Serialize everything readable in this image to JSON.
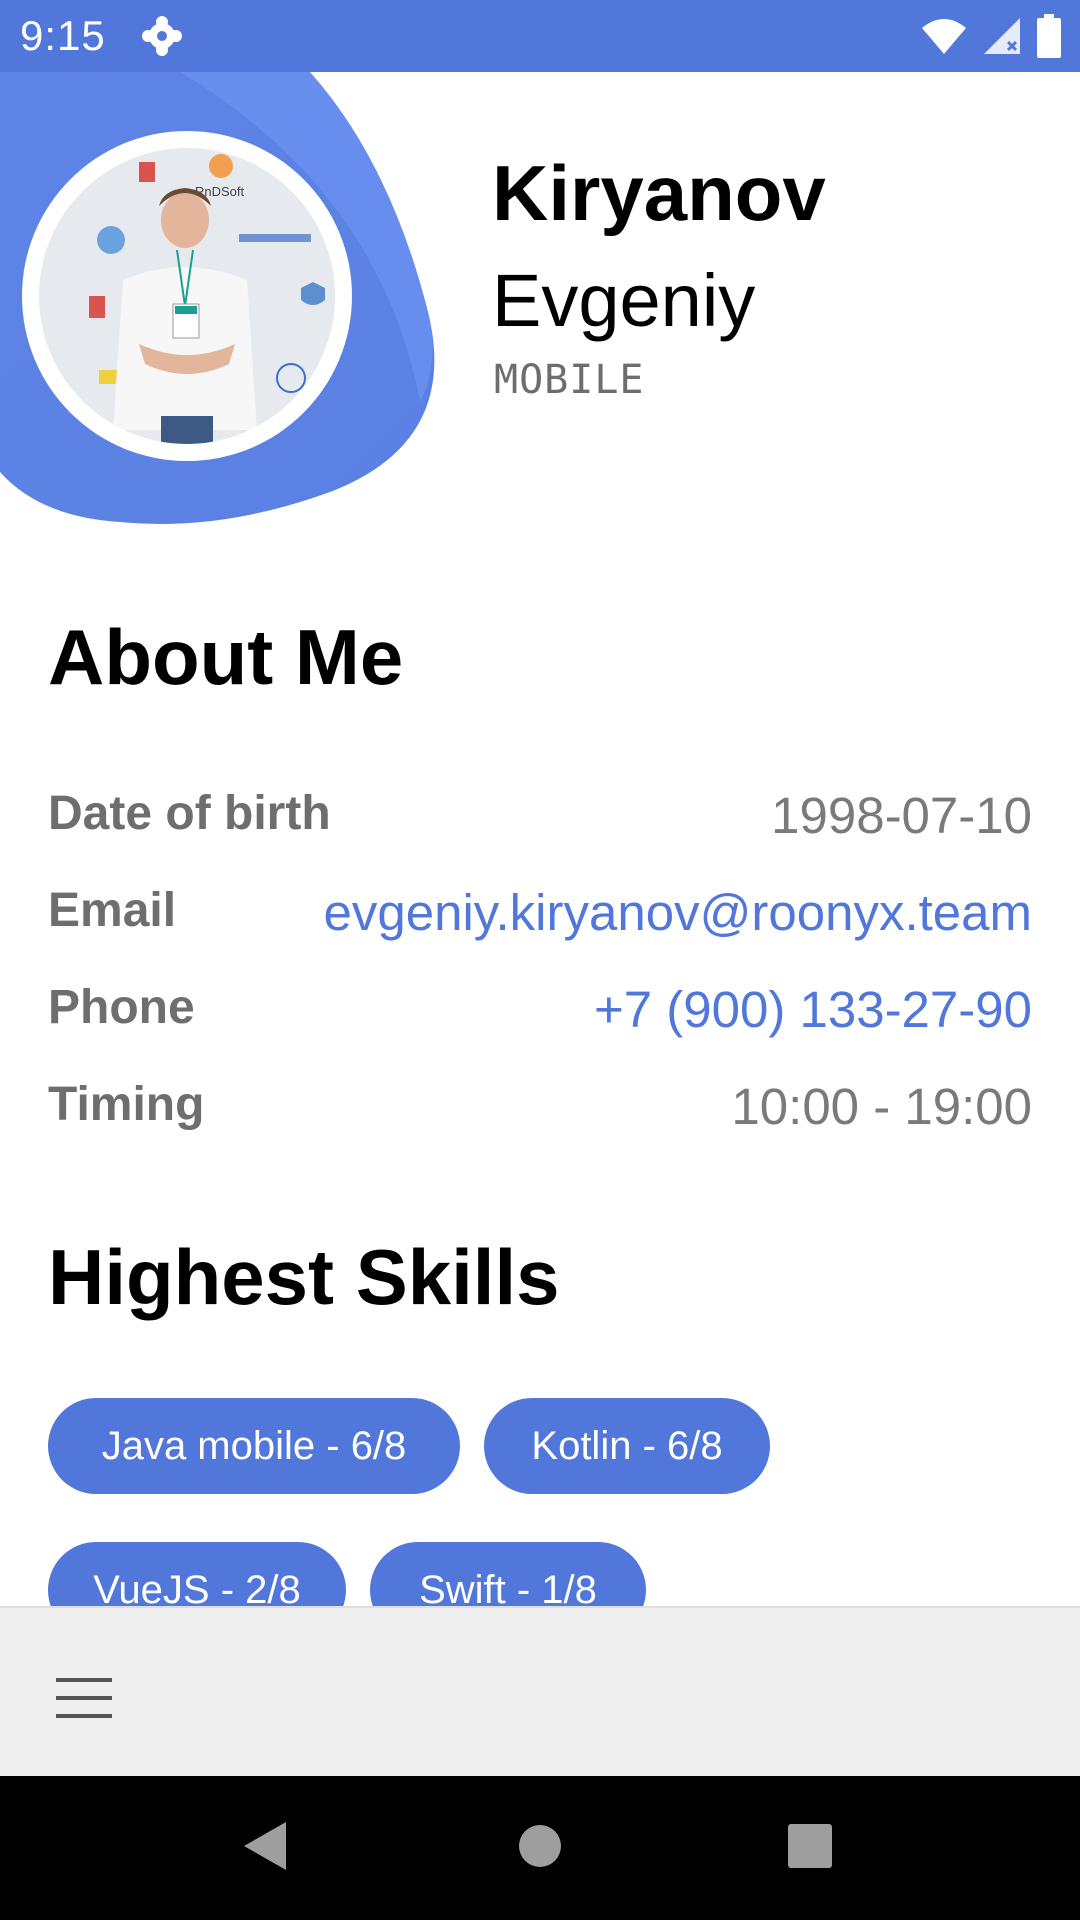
{
  "status_bar": {
    "time": "9:15",
    "background": "#5077d9",
    "icons": [
      "settings-icon",
      "wifi-icon",
      "signal-icon",
      "battery-icon"
    ]
  },
  "profile": {
    "last_name": "Kiryanov",
    "first_name": "Evgeniy",
    "role": "MOBILE",
    "avatar": "profile-photo"
  },
  "about": {
    "title": "About Me",
    "rows": [
      {
        "label": "Date of birth",
        "value": "1998-07-10"
      },
      {
        "label": "Email",
        "value": "evgeniy.kiryanov@roonyx.team"
      },
      {
        "label": "Phone",
        "value": "+7 (900) 133-27-90"
      },
      {
        "label": "Timing",
        "value": "10:00 - 19:00"
      }
    ]
  },
  "skills": {
    "title": "Highest Skills",
    "chips": [
      "Java mobile - 6/8",
      "Kotlin - 6/8",
      "VueJS - 2/8",
      "Swift - 1/8"
    ]
  },
  "bottom_bar": {
    "menu_icon": "menu-icon"
  },
  "nav_bar": {
    "buttons": [
      "back-icon",
      "home-icon",
      "recents-icon"
    ]
  },
  "colors": {
    "accent": "#5077d9",
    "blob": "#6a94f2",
    "label_gray": "#6e6e6e"
  }
}
